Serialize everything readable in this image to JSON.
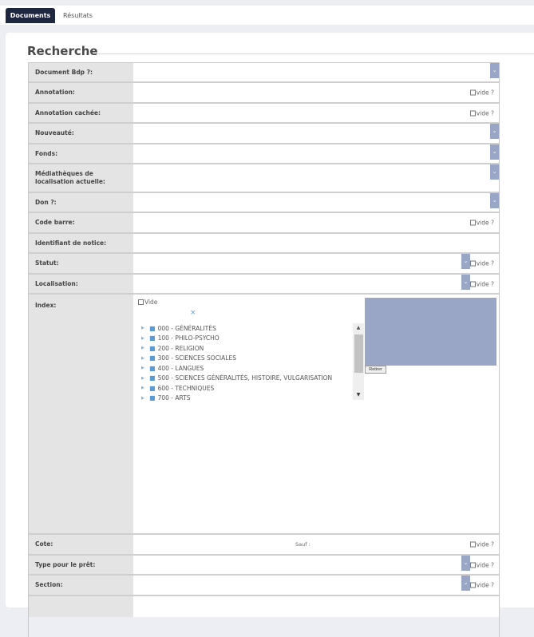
{
  "tabs": [
    {
      "label": "Documents",
      "active": true
    },
    {
      "label": "Résultats",
      "active": false
    }
  ],
  "section": {
    "title": "Recherche"
  },
  "fields": {
    "document_bdp": {
      "label": "Document Bdp ?:"
    },
    "annotation": {
      "label": "Annotation:",
      "vide": "vide ?"
    },
    "annotation_cachee": {
      "label": "Annotation cachée:",
      "vide": "vide ?"
    },
    "nouveaute": {
      "label": "Nouveauté:"
    },
    "fonds": {
      "label": "Fonds:"
    },
    "mediatheques": {
      "label": "Médiathèques de localisation actuelle:"
    },
    "don": {
      "label": "Don ?:"
    },
    "code_barre": {
      "label": "Code barre:",
      "vide": "vide ?"
    },
    "identifiant": {
      "label": "Identifiant de notice:"
    },
    "statut": {
      "label": "Statut:",
      "vide": "vide ?"
    },
    "localisation": {
      "label": "Localisation:",
      "vide": "vide ?"
    },
    "index": {
      "label": "Index:",
      "vide": "Vide",
      "clear": "×",
      "tree": [
        "000 - GÉNÉRALITÉS",
        "100 - PHILO-PSYCHO",
        "200 - RELIGION",
        "300 - SCIENCES SOCIALES",
        "400 - LANGUES",
        "500 - SCIENCES GÉNÉRALITÉS, HISTOIRE, VULGARISATION",
        "600 - TECHNIQUES",
        "700 - ARTS"
      ],
      "remove_button": "Retirer"
    },
    "cote": {
      "label": "Cote:",
      "sauf": "Sauf :",
      "vide": "vide ?"
    },
    "type_pret": {
      "label": "Type pour le prêt:",
      "vide": "vide ?"
    },
    "section": {
      "label": "Section:",
      "vide": "vide ?"
    }
  },
  "icons": {
    "dropdown": "chevron-down-icon",
    "folder": "folder-icon",
    "expand": "caret-right-icon"
  },
  "colors": {
    "tab_active": "#1e2640",
    "dropdown_button": "#9aa6c6",
    "label_bg": "#e4e4e4"
  }
}
